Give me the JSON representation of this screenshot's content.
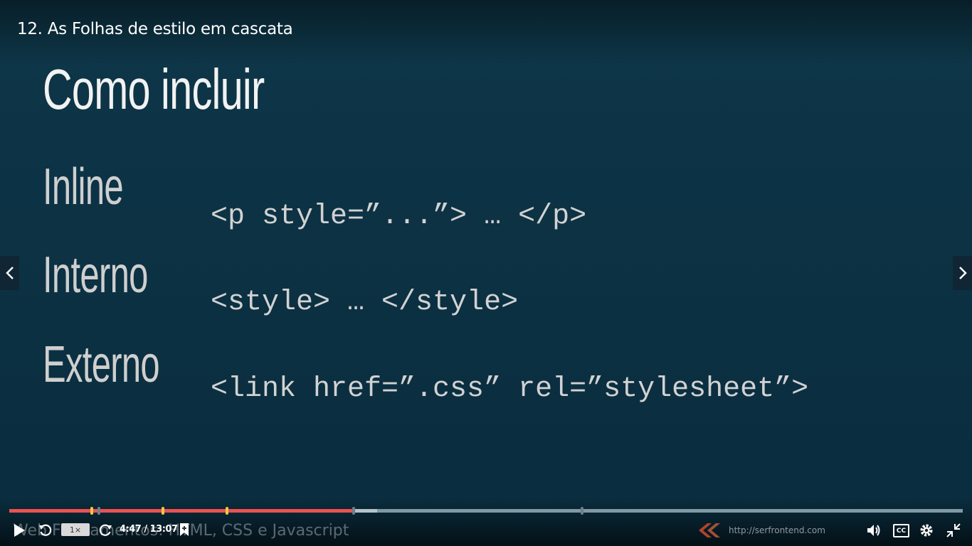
{
  "lecture": {
    "title": "12. As Folhas de estilo em cascata"
  },
  "slide": {
    "heading": "Como incluir",
    "rows": [
      {
        "term": "Inline",
        "code": "<p style=”...”> … </p>"
      },
      {
        "term": "Interno",
        "code": "<style> … </style>"
      },
      {
        "term": "Externo",
        "code": "<link href=”.css” rel=”stylesheet”>"
      }
    ],
    "watermark": "Web Fundamentos: HTML, CSS e Javascript",
    "brand_url": "http://serfrontend.com"
  },
  "player": {
    "progress": {
      "played_fraction": 0.361,
      "buffered_fraction": 0.386
    },
    "speed_label": "1×",
    "time_label": "4:47 / 13:07",
    "cc_label": "CC",
    "colors": {
      "played": "#ec5252",
      "track": "#7f9aa4",
      "bookmark": "#f5c842",
      "chapter": "#6f7f88"
    },
    "icons": [
      "play-icon",
      "rewind-icon",
      "forward-icon",
      "bookmark-add-icon",
      "volume-icon",
      "captions-icon",
      "settings-icon",
      "exit-fullscreen-icon",
      "chevron-left-icon",
      "chevron-right-icon"
    ]
  }
}
